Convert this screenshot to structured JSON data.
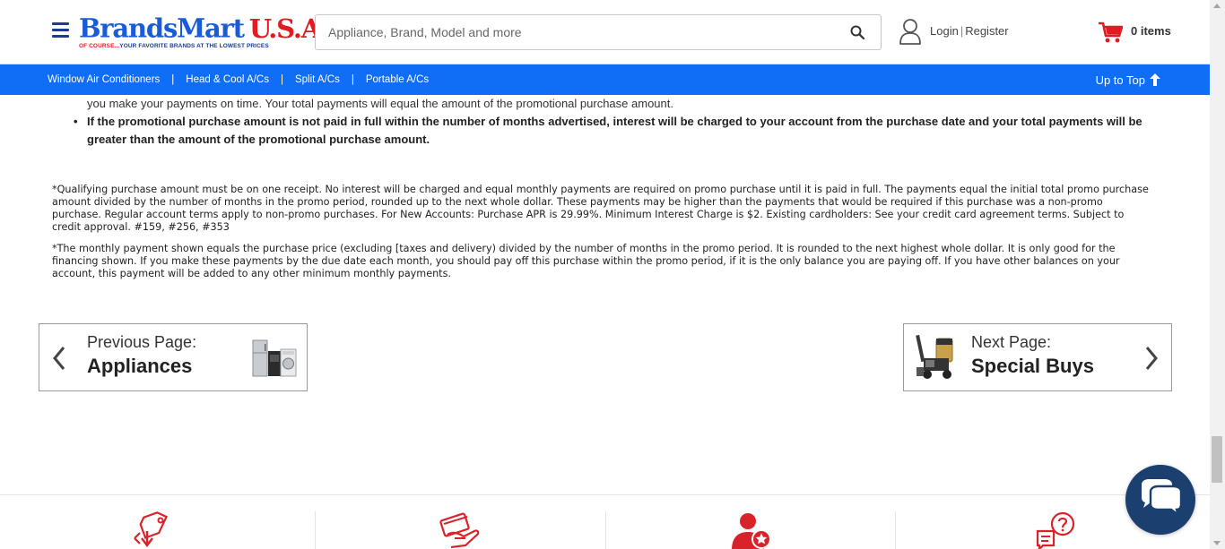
{
  "header": {
    "logo": {
      "brand": "BrandsMart",
      "country": "U.S.A.",
      "registered": "®",
      "tagline_red": "OF COURSE...",
      "tagline_blue": "YOUR FAVORITE BRANDS AT THE LOWEST PRICES"
    },
    "search": {
      "placeholder": "Appliance, Brand, Model and more"
    },
    "login_label": "Login",
    "register_label": "Register",
    "login_separator": "|",
    "cart_count": "0 items"
  },
  "nav": {
    "items": [
      {
        "label": "Window Air Conditioners"
      },
      {
        "label": "Head & Cool A/Cs"
      },
      {
        "label": "Split A/Cs"
      },
      {
        "label": "Portable A/Cs"
      }
    ],
    "separator": "|",
    "up_to_top": "Up to Top"
  },
  "content": {
    "partial_line": "you make your payments on time.  Your total payments will equal the amount of the promotional purchase amount.",
    "bullet_bold": "If the promotional purchase amount is not paid in full within the number of months advertised, interest will be charged to your account from the purchase date and your total payments will be greater than the amount of the promotional purchase amount.",
    "fine_print_1": "*Qualifying purchase amount must be on one receipt. No interest will be charged and equal monthly payments are required on promo purchase until it is paid in full. The payments equal the initial total promo purchase amount divided by the number of months in the promo period, rounded up to the next whole dollar. These payments may be higher than the payments that would be required if this purchase was a non-promo purchase. Regular account terms apply to non-promo purchases. For New Accounts: Purchase APR is 29.99%. Minimum Interest Charge is $2. Existing cardholders: See your credit card agreement terms. Subject to credit approval. #159, #256, #353",
    "fine_print_2": "*The monthly payment shown equals the purchase price (excluding [taxes and delivery) divided by the number of months in the promo period. It is rounded to the next highest whole dollar. It is only good for the financing shown. If you make these payments by the due date each month, you should pay off this purchase within the promo period, if it is the only balance you are paying off. If you have other balances on your account, this payment will be added to any other minimum monthly payments."
  },
  "pagination": {
    "previous": {
      "sub": "Previous Page:",
      "title": "Appliances"
    },
    "next": {
      "sub": "Next Page:",
      "title": "Special Buys"
    }
  },
  "colors": {
    "nav_blue": "#0f6ef5",
    "brand_blue": "#1a5bd6",
    "brand_red": "#e01b22",
    "chat_navy": "#1b3f6e",
    "icon_red": "#d9232a"
  },
  "footer_icons": [
    "price-tag-down-icon",
    "hand-card-icon",
    "user-star-icon",
    "chat-question-icon"
  ]
}
